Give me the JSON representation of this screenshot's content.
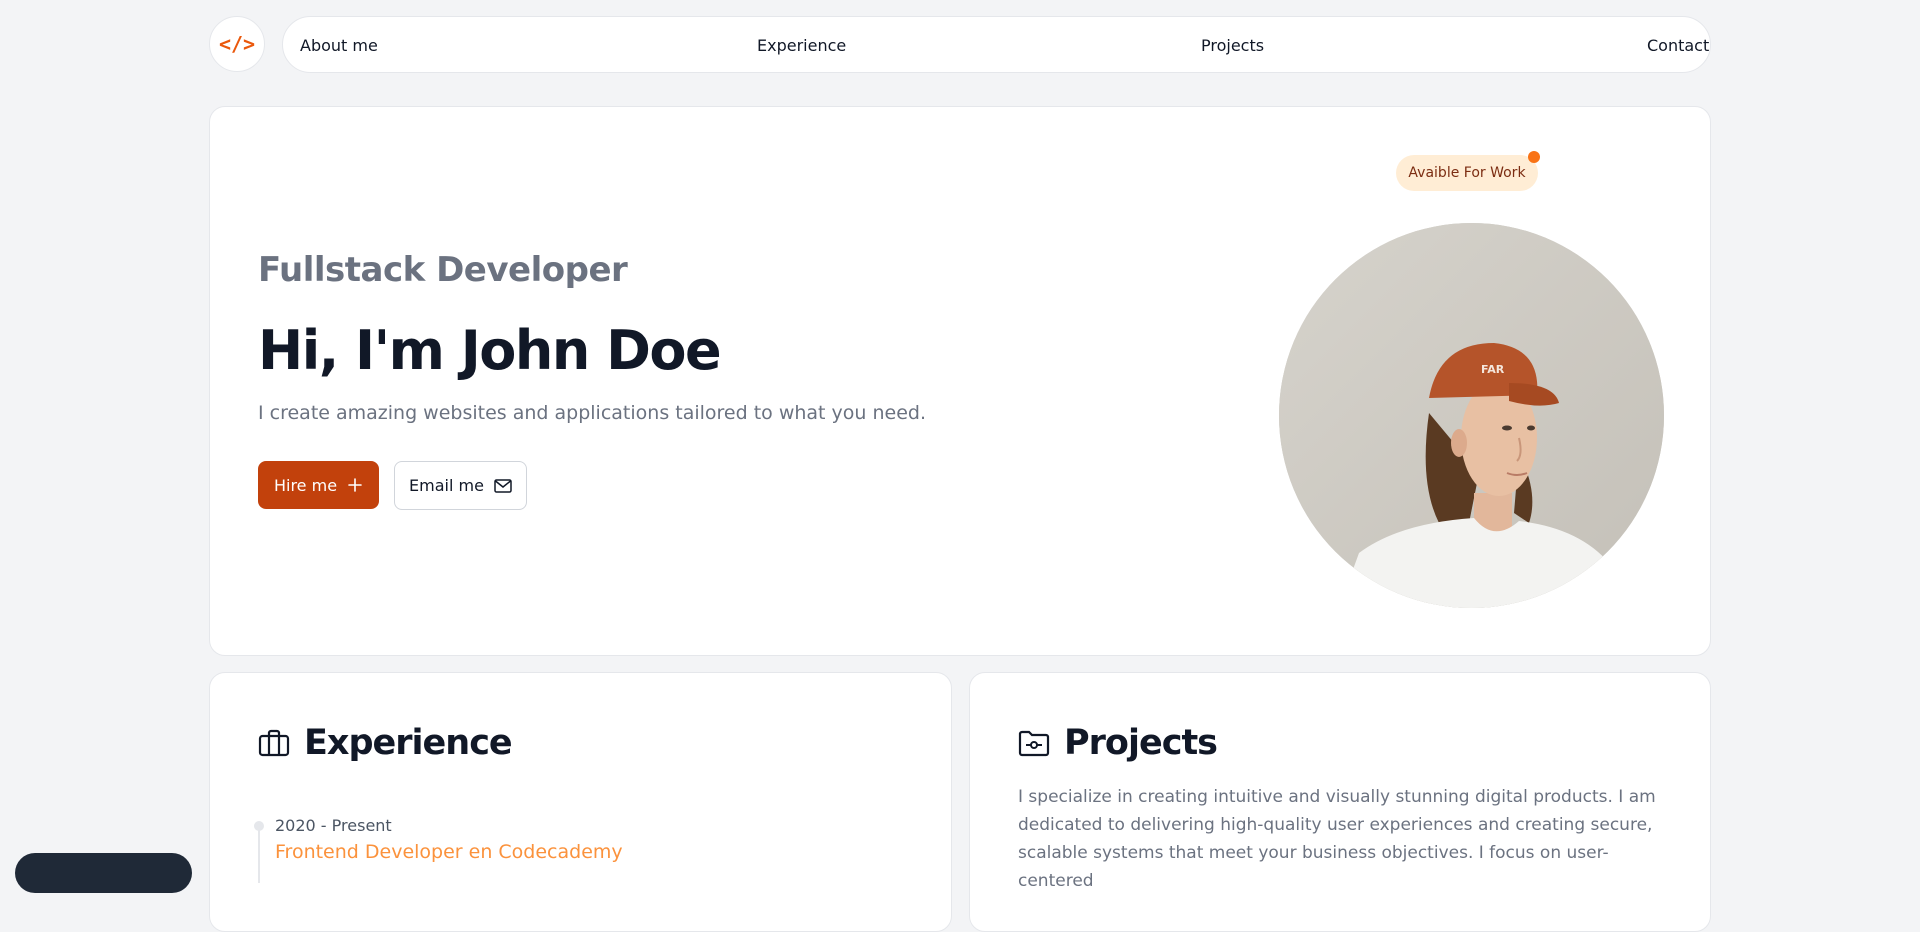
{
  "nav": {
    "logo": "</>",
    "links": [
      "About me",
      "Experience",
      "Projects",
      "Contact"
    ]
  },
  "hero": {
    "role": "Fullstack Developer",
    "greeting": "Hi, I'm John Doe",
    "tagline": "I create amazing websites and applications tailored to what you need.",
    "hire_label": "Hire me",
    "email_label": "Email me",
    "badge": "Avaible For Work"
  },
  "experience": {
    "title": "Experience",
    "items": [
      {
        "period": "2020 - Present",
        "role": "Frontend Developer en Codecademy"
      }
    ]
  },
  "projects": {
    "title": "Projects",
    "description": "I specialize in creating intuitive and visually stunning digital products. I am dedicated to delivering high-quality user experiences and creating secure, scalable systems that meet your business objectives. I focus on user-centered"
  },
  "colors": {
    "accent": "#ea580c",
    "hire_button": "#c2410c",
    "badge_bg": "#ffedd5",
    "job_title": "#fb923c",
    "page_bg": "#f3f4f6"
  },
  "icons": [
    "code-icon",
    "plus-icon",
    "mail-icon",
    "briefcase-icon",
    "folder-icon"
  ]
}
